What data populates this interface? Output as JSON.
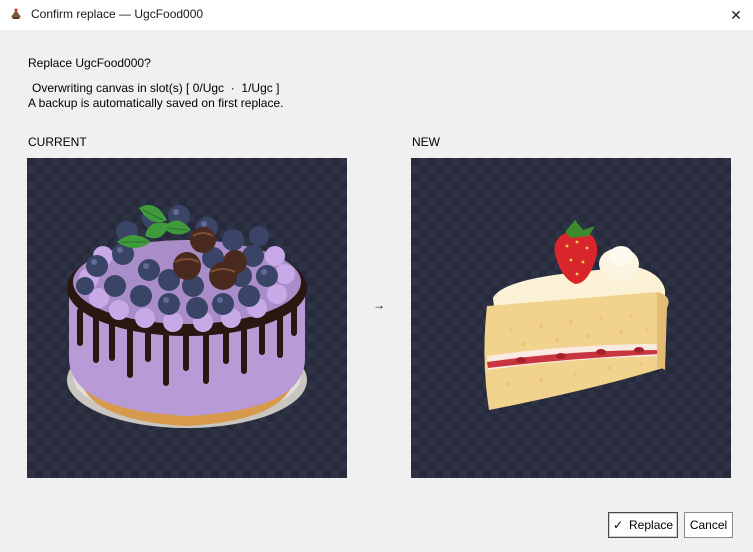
{
  "window": {
    "title": "Confirm replace — UgcFood000",
    "close_glyph": "✕",
    "icon": "cake-app-icon"
  },
  "dialog": {
    "heading": "Replace UgcFood000?",
    "line1": "Overwriting canvas in slot(s) [ 0/Ugc  ·  1/Ugc ]",
    "line2": "A backup is automatically saved on first replace.",
    "current_label": "CURRENT",
    "new_label": "NEW",
    "arrow": "→"
  },
  "previews": {
    "current_icon": "blueberry-cake-image",
    "new_icon": "strawberry-cake-slice-image"
  },
  "buttons": {
    "replace_check": "✓",
    "replace_label": "Replace",
    "cancel_label": "Cancel"
  },
  "colors": {
    "client_bg": "#f0f0f0",
    "checker_dark": "#262a3b",
    "checker_light": "#2d3245"
  }
}
